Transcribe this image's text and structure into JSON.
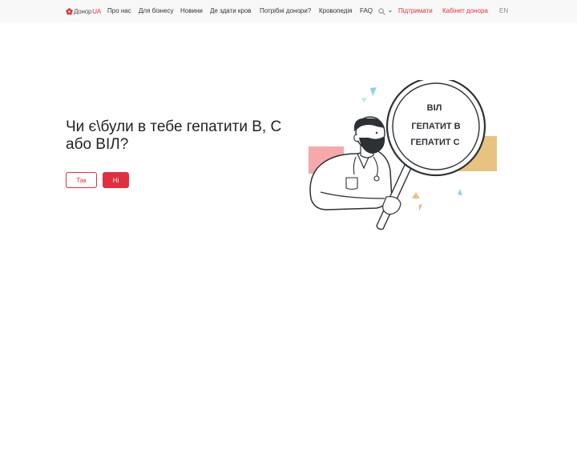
{
  "navbar": {
    "logo_prefix": "Донор",
    "logo_suffix": "UA",
    "items": [
      {
        "label": "Про нас"
      },
      {
        "label": "Для бізнесу"
      },
      {
        "label": "Новини"
      },
      {
        "label": "Де здати кров"
      },
      {
        "label": "Потрібні донори?"
      },
      {
        "label": "Кровопедія"
      },
      {
        "label": "FAQ"
      }
    ],
    "support_label": "Підтримати",
    "donor_cabinet_label": "Кабінет донора",
    "language_label": "EN",
    "icons": [
      "flower-logo-icon",
      "search-icon",
      "caret-down-icon"
    ]
  },
  "main": {
    "question": "Чи є\\були в тебе гепатити B, C або ВІЛ?",
    "yes_label": "Так",
    "no_label": "Ні"
  },
  "illustration": {
    "lens_lines": [
      "ВІЛ",
      "ГЕПАТИТ В",
      "ГЕПАТИТ С"
    ]
  },
  "colors": {
    "accent": "#e0303f",
    "navbar_bg": "#f8f8f9",
    "pink_block": "#f5a9ab",
    "gold_block": "#e7c382",
    "teal_shard": "#8fd3e0"
  }
}
